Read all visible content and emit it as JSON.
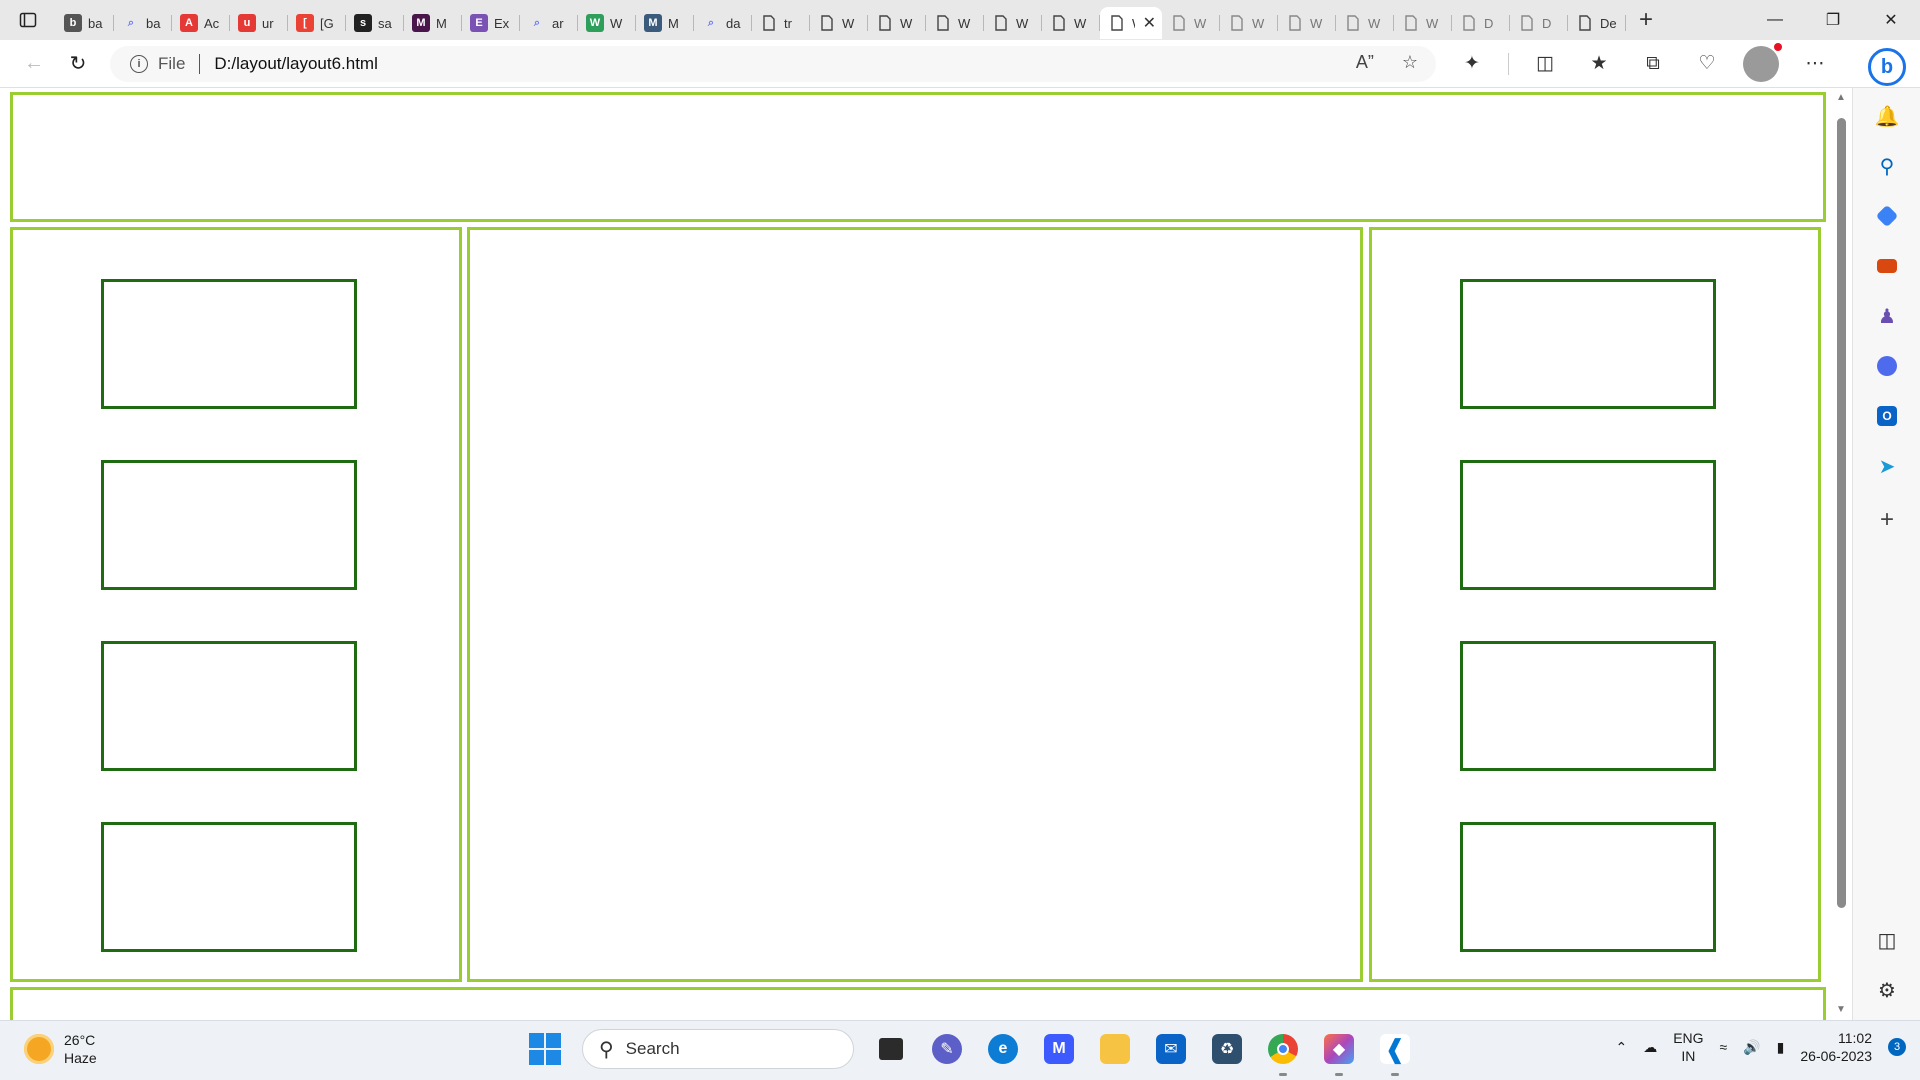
{
  "tabs": [
    {
      "title": "ba",
      "icon": "medium-icon",
      "color": "#555555"
    },
    {
      "title": "ba",
      "icon": "search-icon",
      "color": "#6b7cff"
    },
    {
      "title": "Ac",
      "icon": "acrobat-icon",
      "color": "#e53935"
    },
    {
      "title": "ur",
      "icon": "acrobat-icon",
      "color": "#e53935"
    },
    {
      "title": "[G",
      "icon": "gmail-icon",
      "color": "#ea4335"
    },
    {
      "title": "sa",
      "icon": "github-icon",
      "color": "#222222"
    },
    {
      "title": "M",
      "icon": "slack-icon",
      "color": "#4a154b"
    },
    {
      "title": "Ex",
      "icon": "bootstrap-icon",
      "color": "#7952b3"
    },
    {
      "title": "ar",
      "icon": "search-icon",
      "color": "#6b7cff"
    },
    {
      "title": "W",
      "icon": "w-icon",
      "color": "#2e9e5b"
    },
    {
      "title": "M",
      "icon": "mysql-icon",
      "color": "#3b5b7c"
    },
    {
      "title": "da",
      "icon": "search-icon",
      "color": "#6b7cff"
    },
    {
      "title": "tr",
      "icon": "page-icon",
      "color": "#444444"
    },
    {
      "title": "W",
      "icon": "page-icon",
      "color": "#444444"
    },
    {
      "title": "W",
      "icon": "page-icon",
      "color": "#444444"
    },
    {
      "title": "W",
      "icon": "page-icon",
      "color": "#444444"
    },
    {
      "title": "W",
      "icon": "page-icon",
      "color": "#444444"
    },
    {
      "title": "W",
      "icon": "page-icon",
      "color": "#444444"
    },
    {
      "title": "W",
      "icon": "page-icon",
      "color": "#444444",
      "active": true
    },
    {
      "title": "W",
      "icon": "page-icon",
      "color": "#888888"
    },
    {
      "title": "W",
      "icon": "page-icon",
      "color": "#888888"
    },
    {
      "title": "W",
      "icon": "page-icon",
      "color": "#888888"
    },
    {
      "title": "W",
      "icon": "page-icon",
      "color": "#888888"
    },
    {
      "title": "W",
      "icon": "page-icon",
      "color": "#888888"
    },
    {
      "title": "D",
      "icon": "page-icon",
      "color": "#888888"
    },
    {
      "title": "D",
      "icon": "page-icon",
      "color": "#888888"
    },
    {
      "title": "De",
      "icon": "page-icon",
      "color": "#444444"
    }
  ],
  "address": {
    "scheme": "File",
    "url": "D:/layout/layout6.html"
  },
  "page_colors": {
    "panel_border": "#9acd32",
    "box_border": "#1e6b12"
  },
  "taskbar": {
    "weather_temp": "26°C",
    "weather_desc": "Haze",
    "search_placeholder": "Search",
    "lang": "ENG",
    "region": "IN",
    "time": "11:02",
    "date": "26-06-2023",
    "notifications": "3"
  }
}
